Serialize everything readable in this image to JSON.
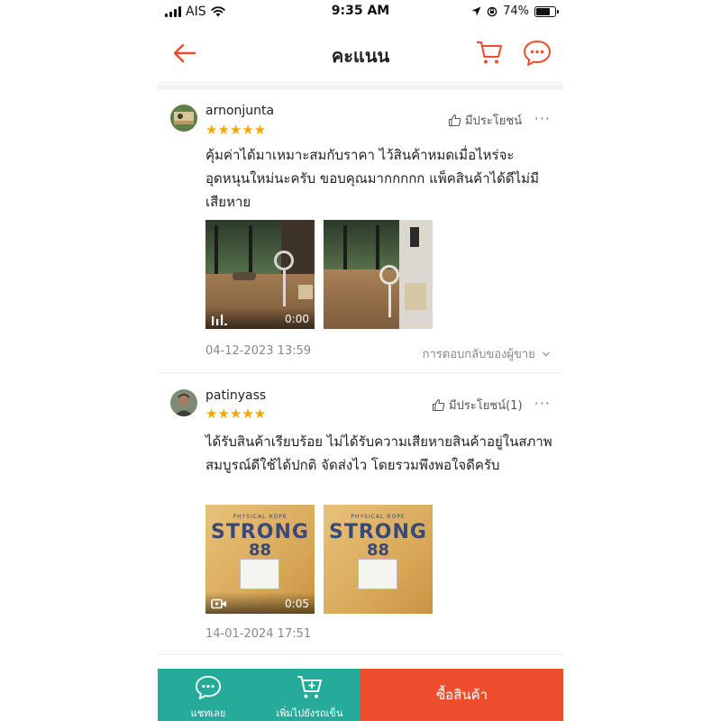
{
  "status_bar": {
    "carrier": "AIS",
    "time": "9:35 AM",
    "battery": "74%",
    "battery_level": 0.74
  },
  "header": {
    "title": "คะแนน",
    "back_icon": "arrow-left-icon",
    "cart_icon": "cart-icon",
    "chat_icon": "chat-icon",
    "accent_color": "#ee4d2d"
  },
  "reviews": [
    {
      "username": "arnonjunta",
      "rating": 5,
      "stars": "★★★★★",
      "helpful_label": "มีประโยชน์",
      "more_label": "···",
      "text": "คุ้มค่าได้มาเหมาะสมกับราคา ไว้สินค้าหมดเมื่อไหร่จะอุดหนุนใหม่นะครับ ขอบคุณมากกกกก แพ็คสินค้าได้ดีไม่มีเสียหาย",
      "media": [
        {
          "type": "video",
          "icon": "video-bars-icon",
          "duration": "0:00"
        },
        {
          "type": "photo"
        }
      ],
      "date": "04-12-2023 13:59",
      "seller_reply_label": "การตอบกลับของผู้ขาย"
    },
    {
      "username": "patinyass",
      "rating": 5,
      "stars": "★★★★★",
      "helpful_label": "มีประโยชน์(1)",
      "more_label": "···",
      "text": "ได้รับสินค้าเรียบร้อย ไม่ได้รับความเสียหายสินค้าอยู่ในสภาพสมบูรณ์ดีใช้ได้ปกติ จัดส่งไว โดยรวมพึงพอใจดีครับ",
      "media": [
        {
          "type": "video",
          "icon": "video-camera-icon",
          "duration": "0:05",
          "box_top": "PHYSICAL ROPE",
          "box_brand": "STRONG",
          "box_num": "88"
        },
        {
          "type": "photo",
          "box_top": "PHYSICAL ROPE",
          "box_brand": "STRONG",
          "box_num": "88"
        }
      ],
      "date": "14-01-2024 17:51"
    }
  ],
  "bottom_bar": {
    "chat_label": "แชทเลย",
    "add_to_cart_label": "เพิ่มไปยังรถเข็น",
    "buy_label": "ซื้อสินค้า",
    "secondary_color": "#26aa99",
    "primary_color": "#ee4d2d"
  }
}
